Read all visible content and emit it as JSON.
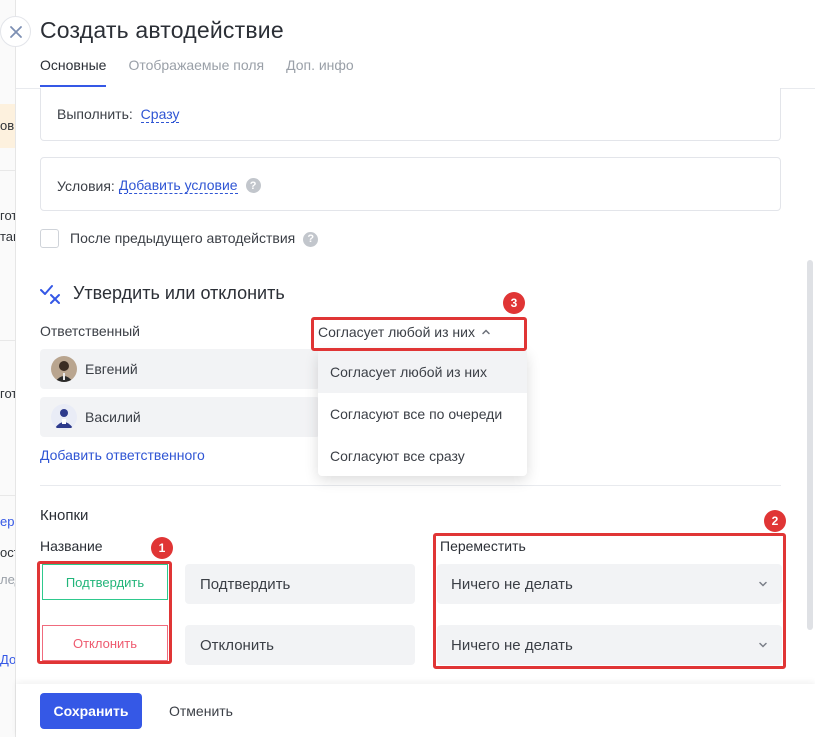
{
  "modal": {
    "title": "Создать автодействие",
    "tabs": [
      {
        "label": "Основные",
        "active": true
      },
      {
        "label": "Отображаемые поля",
        "active": false
      },
      {
        "label": "Доп. инфо",
        "active": false
      }
    ]
  },
  "execute": {
    "label": "Выполнить:",
    "value": "Сразу"
  },
  "conditions": {
    "label": "Условия:",
    "link": "Добавить условие",
    "help_icon": "question-icon"
  },
  "after_previous": {
    "label": "После предыдущего автодействия",
    "checked": false
  },
  "approval": {
    "title": "Утвердить или отклонить",
    "responsible_label": "Ответственный",
    "mode_selected": "Согласует любой из них",
    "mode_options": [
      "Согласует любой из них",
      "Согласуют все по очереди",
      "Согласуют все сразу"
    ],
    "people": [
      {
        "name": "Евгений"
      },
      {
        "name": "Василий"
      }
    ],
    "add_responsible": "Добавить ответственного"
  },
  "buttons_section": {
    "title": "Кнопки",
    "name_label": "Название",
    "move_label": "Переместить",
    "rows": [
      {
        "preview": "Подтвердить",
        "name": "Подтвердить",
        "move": "Ничего не делать"
      },
      {
        "preview": "Отклонить",
        "name": "Отклонить",
        "move": "Ничего не делать"
      }
    ]
  },
  "annotations": [
    "1",
    "2",
    "3"
  ],
  "footer": {
    "save": "Сохранить",
    "cancel": "Отменить"
  },
  "background_fragments": [
    "ов",
    "гот",
    "тан",
    "гот",
    "ере",
    "ост",
    "лед",
    "До"
  ],
  "colors": {
    "accent": "#3558e6",
    "confirm": "#22b57a",
    "reject": "#ee5a6f",
    "annotation": "#e03535"
  }
}
